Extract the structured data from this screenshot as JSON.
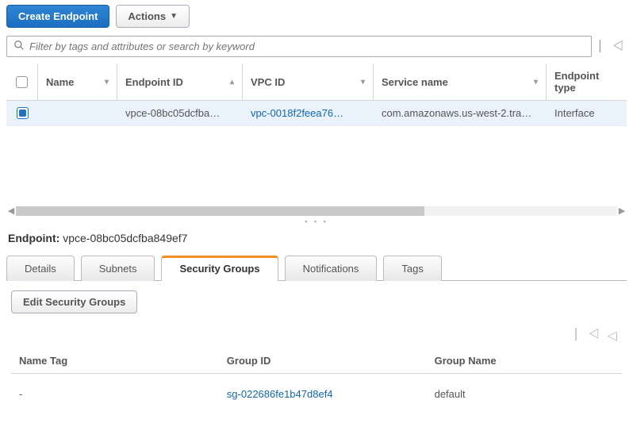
{
  "toolbar": {
    "create_label": "Create Endpoint",
    "actions_label": "Actions"
  },
  "search": {
    "placeholder": "Filter by tags and attributes or search by keyword"
  },
  "columns": {
    "name": "Name",
    "endpoint_id": "Endpoint ID",
    "vpc_id": "VPC ID",
    "service_name": "Service name",
    "endpoint_type": "Endpoint type"
  },
  "rows": [
    {
      "name": "",
      "endpoint_id": "vpce-08bc05dcfba…",
      "vpc_id": "vpc-0018f2feea76…",
      "service_name": "com.amazonaws.us-west-2.tra…",
      "endpoint_type": "Interface"
    }
  ],
  "detail": {
    "prefix": "Endpoint:",
    "id": "vpce-08bc05dcfba849ef7"
  },
  "tabs": {
    "details": "Details",
    "subnets": "Subnets",
    "security_groups": "Security Groups",
    "notifications": "Notifications",
    "tags": "Tags"
  },
  "sg": {
    "edit_label": "Edit Security Groups",
    "cols": {
      "name_tag": "Name Tag",
      "group_id": "Group ID",
      "group_name": "Group Name"
    },
    "rows": [
      {
        "name_tag": "-",
        "group_id": "sg-022686fe1b47d8ef4",
        "group_name": "default"
      }
    ]
  }
}
